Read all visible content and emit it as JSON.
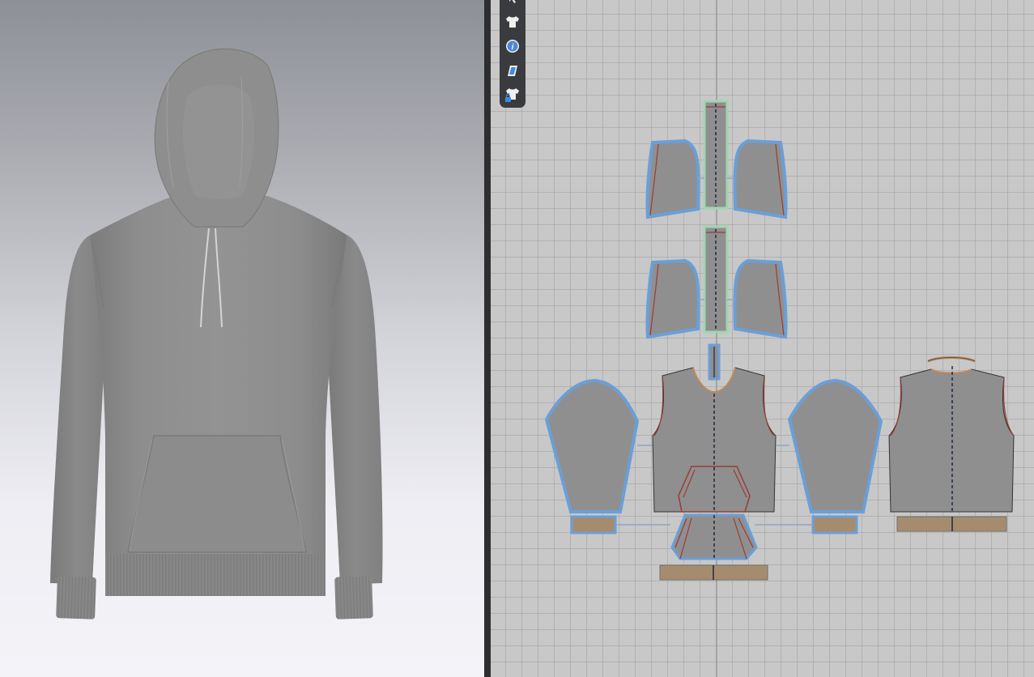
{
  "app": {
    "views": [
      "3d-garment-view",
      "2d-pattern-view"
    ]
  },
  "toolbar": {
    "tools": [
      {
        "name": "select-tool",
        "icon": "arrow-icon"
      },
      {
        "name": "show-avatar-garment-tool",
        "icon": "tshirt-icon"
      },
      {
        "name": "information-tool",
        "icon": "info-icon"
      },
      {
        "name": "fabric-tool",
        "icon": "fabric-swatch-icon"
      },
      {
        "name": "lock-garment-tool",
        "icon": "tshirt-lock-icon"
      }
    ]
  },
  "garment": {
    "type": "hoodie",
    "fabric_color": "#8c8c8c"
  },
  "colors": {
    "pattern_fill": "#8f8f8f",
    "seam_blue": "#6a9fd8",
    "seam_red": "#9b3b34",
    "rib_fabric": "#a68c6e",
    "grid_bg": "#c8c8c8",
    "toolbar_bg": "#3a3b3e"
  }
}
